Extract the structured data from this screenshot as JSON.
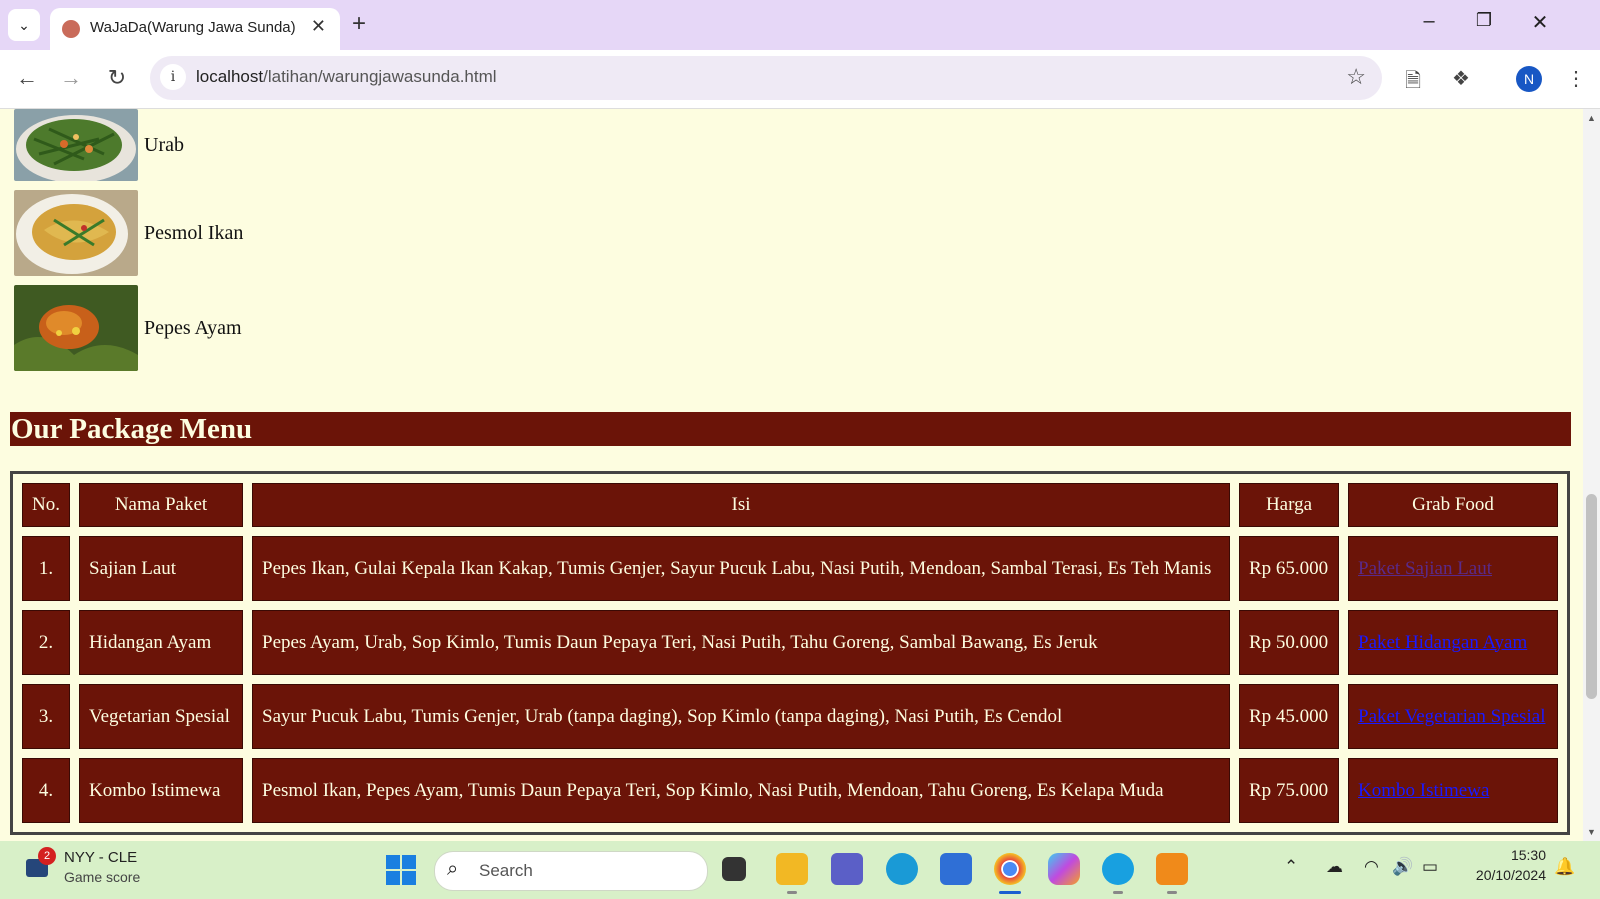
{
  "browser": {
    "tab_title": "WaJaDa(Warung Jawa Sunda)",
    "url_host": "localhost",
    "url_path": "/latihan/warungjawasunda.html",
    "profile_initial": "N",
    "accent": "#e6d7f7"
  },
  "menu_items": [
    {
      "name": "Urab",
      "thumb_color": "#5a7a3a"
    },
    {
      "name": "Pesmol Ikan",
      "thumb_color": "#c9a24a"
    },
    {
      "name": "Pepes Ayam",
      "thumb_color": "#b8621c"
    }
  ],
  "section": {
    "title": "Our Package Menu",
    "color": "#6b1408"
  },
  "table": {
    "headers": [
      "No.",
      "Nama Paket",
      "Isi",
      "Harga",
      "Grab Food"
    ],
    "rows": [
      {
        "no": "1.",
        "name": "Sajian Laut",
        "isi": "Pepes Ikan, Gulai Kepala Ikan Kakap, Tumis Genjer, Sayur Pucuk Labu, Nasi Putih, Mendoan, Sambal Terasi, Es Teh Manis",
        "harga": "Rp 65.000",
        "link": "Paket Sajian Laut"
      },
      {
        "no": "2.",
        "name": "Hidangan Ayam",
        "isi": "Pepes Ayam, Urab, Sop Kimlo, Tumis Daun Pepaya Teri, Nasi Putih, Tahu Goreng, Sambal Bawang, Es Jeruk",
        "harga": "Rp 50.000",
        "link": "Paket Hidangan Ayam"
      },
      {
        "no": "3.",
        "name": "Vegetarian Spesial",
        "isi": "Sayur Pucuk Labu, Tumis Genjer, Urab (tanpa daging), Sop Kimlo (tanpa daging), Nasi Putih, Es Cendol",
        "harga": "Rp 45.000",
        "link": "Paket Vegetarian Spesial"
      },
      {
        "no": "4.",
        "name": "Kombo Istimewa",
        "isi": "Pesmol Ikan, Pepes Ayam, Tumis Daun Pepaya Teri, Sop Kimlo, Nasi Putih, Mendoan, Tahu Goreng, Es Kelapa Muda",
        "harga": "Rp 75.000",
        "link": "Kombo Istimewa"
      }
    ]
  },
  "taskbar": {
    "weather_title": "NYY - CLE",
    "weather_sub": "Game score",
    "weather_badge": "2",
    "search_placeholder": "Search",
    "time": "15:30",
    "date": "20/10/2024"
  }
}
